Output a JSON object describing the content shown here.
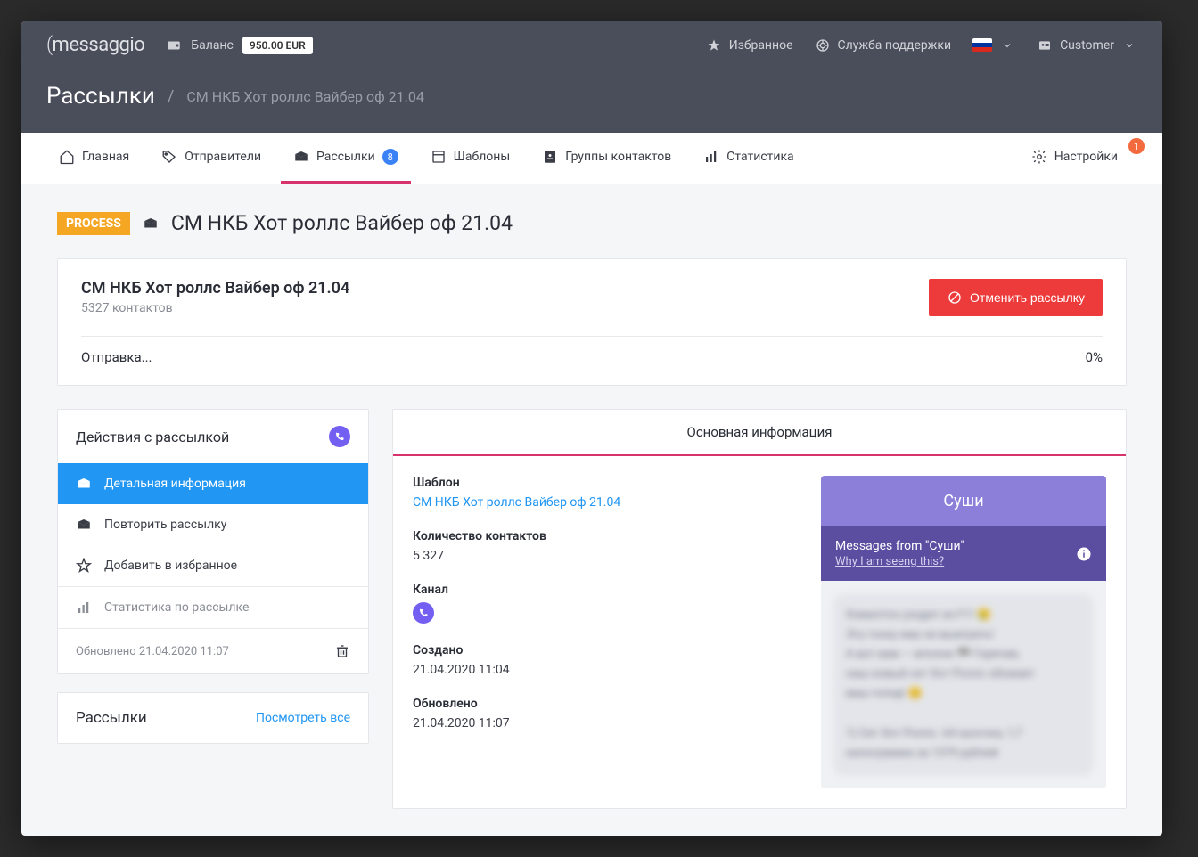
{
  "header": {
    "logo": "messaggio",
    "balance_label": "Баланс",
    "balance_amount": "950.00 EUR",
    "favorites": "Избранное",
    "support": "Служба поддержки",
    "customer": "Customer"
  },
  "breadcrumb": {
    "root": "Рассылки",
    "current": "СМ НКБ Хот роллс Вайбер оф 21.04"
  },
  "nav": {
    "home": "Главная",
    "senders": "Отправители",
    "campaigns": "Рассылки",
    "campaigns_badge": "8",
    "templates": "Шаблоны",
    "contact_groups": "Группы контактов",
    "statistics": "Статистика",
    "settings": "Настройки",
    "settings_notif": "1"
  },
  "page": {
    "status": "PROCESS",
    "title": "СМ НКБ Хот роллс Вайбер оф 21.04"
  },
  "summary": {
    "name": "СМ НКБ Хот роллс Вайбер оф 21.04",
    "contacts": "5327 контактов",
    "cancel": "Отменить рассылку",
    "sending": "Отправка...",
    "percent": "0%"
  },
  "actions": {
    "title": "Действия с рассылкой",
    "detail": "Детальная информация",
    "repeat": "Повторить рассылку",
    "favorite": "Добавить в избранное",
    "stats": "Статистика по рассылке",
    "updated": "Обновлено 21.04.2020 11:07"
  },
  "extra": {
    "title": "Рассылки",
    "view_all": "Посмотреть все"
  },
  "info": {
    "tab": "Основная информация",
    "template_label": "Шаблон",
    "template_value": "СМ НКБ Хот роллс Вайбер оф 21.04",
    "contacts_label": "Количество контактов",
    "contacts_value": "5 327",
    "channel_label": "Канал",
    "created_label": "Создано",
    "created_value": "21.04.2020 11:04",
    "updated_label": "Обновлено",
    "updated_value": "21.04.2020 11:07"
  },
  "preview": {
    "sender": "Суши",
    "messages_from": "Messages from \"Суши\"",
    "why": "Why I am seeng this?",
    "blurred_text": "Хэмилтон уходит из F1! 😢\nЭту гонку ему не выиграть!\nА вот вам — вполне 🏁 Горячие,\nнаш новый сет Хот Роллс обожает\nваш голод! 😊\n\n1) Сет Хот Роллс. 64 кусочка, 1,7\nкилограмма за 1379 рублей"
  }
}
